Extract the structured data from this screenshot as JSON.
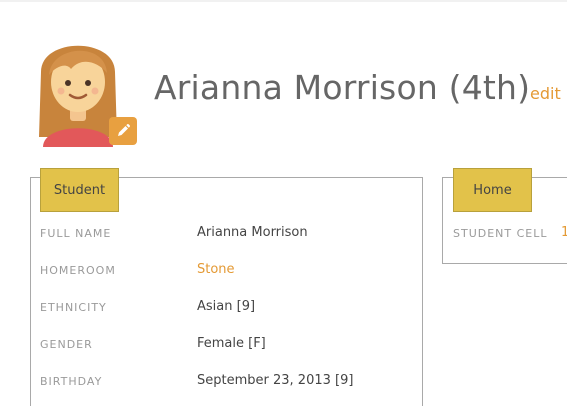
{
  "header": {
    "name": "Arianna Morrison (4th)",
    "edit_label": "edit"
  },
  "avatar": {
    "icon": "student-avatar-girl",
    "edit_icon": "pencil-icon"
  },
  "student_panel": {
    "tab_label": "Student",
    "fields": [
      {
        "label": "FULL NAME",
        "value": "Arianna Morrison"
      },
      {
        "label": "HOMEROOM",
        "value": "Stone"
      },
      {
        "label": "ETHNICITY",
        "value": "Asian [9]"
      },
      {
        "label": "GENDER",
        "value": "Female [F]"
      },
      {
        "label": "BIRTHDAY",
        "value": "September 23, 2013 [9]"
      }
    ]
  },
  "home_panel": {
    "tab_label": "Home",
    "fields": [
      {
        "label": "STUDENT CELL",
        "value": "1"
      }
    ]
  },
  "colors": {
    "accent": "#e49a35",
    "tab": "#e2c24a",
    "label": "#9a9a9a",
    "text": "#444444"
  }
}
